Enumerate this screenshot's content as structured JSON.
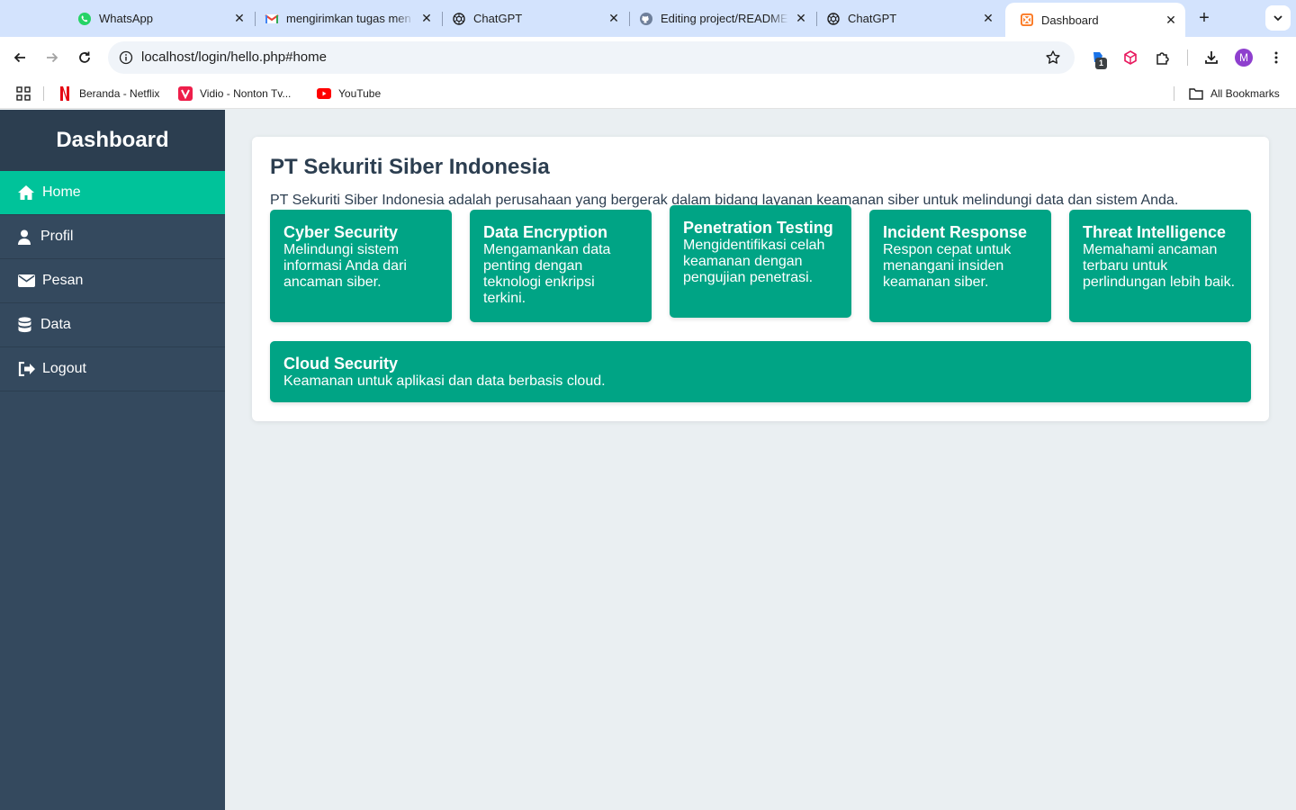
{
  "browser": {
    "tabs": [
      {
        "title": "WhatsApp",
        "icon": "whatsapp-icon"
      },
      {
        "title": "mengirimkan tugas men",
        "icon": "gmail-icon"
      },
      {
        "title": "ChatGPT",
        "icon": "openai-icon"
      },
      {
        "title": "Editing project/README",
        "icon": "github-icon"
      },
      {
        "title": "ChatGPT",
        "icon": "openai-icon"
      },
      {
        "title": "Dashboard",
        "icon": "xampp-icon",
        "active": true
      }
    ],
    "url": "localhost/login/hello.php#home",
    "profile_initial": "M",
    "extension_badge": "1",
    "bookmarks": [
      {
        "label": "Beranda - Netflix",
        "icon": "netflix-icon"
      },
      {
        "label": "Vidio - Nonton Tv...",
        "icon": "vidio-icon"
      },
      {
        "label": "YouTube",
        "icon": "youtube-icon"
      }
    ],
    "all_bookmarks": "All Bookmarks"
  },
  "sidebar": {
    "title": "Dashboard",
    "items": [
      {
        "label": "Home",
        "icon": "home-icon",
        "active": true
      },
      {
        "label": "Profil",
        "icon": "user-icon"
      },
      {
        "label": "Pesan",
        "icon": "envelope-icon"
      },
      {
        "label": "Data",
        "icon": "database-icon"
      },
      {
        "label": "Logout",
        "icon": "logout-icon"
      }
    ]
  },
  "main": {
    "title": "PT Sekuriti Siber Indonesia",
    "description": "PT Sekuriti Siber Indonesia adalah perusahaan yang bergerak dalam bidang layanan keamanan siber untuk melindungi data dan sistem Anda.",
    "services": [
      {
        "title": "Cyber Security",
        "description": "Melindungi sistem informasi Anda dari ancaman siber."
      },
      {
        "title": "Data Encryption",
        "description": "Mengamankan data penting dengan teknologi enkripsi terkini."
      },
      {
        "title": "Penetration Testing",
        "description": "Mengidentifikasi celah keamanan dengan pengujian penetrasi."
      },
      {
        "title": "Incident Response",
        "description": "Respon cepat untuk menangani insiden keamanan siber."
      },
      {
        "title": "Threat Intelligence",
        "description": "Memahami ancaman terbaru untuk perlindungan lebih baik."
      },
      {
        "title": "Cloud Security",
        "description": "Keamanan untuk aplikasi dan data berbasis cloud."
      }
    ]
  },
  "colors": {
    "sidebar_bg": "#34495e",
    "sidebar_header_bg": "#2c3e50",
    "active_item": "#00c39a",
    "service_card": "#00a485",
    "page_bg": "#eaeff2"
  }
}
